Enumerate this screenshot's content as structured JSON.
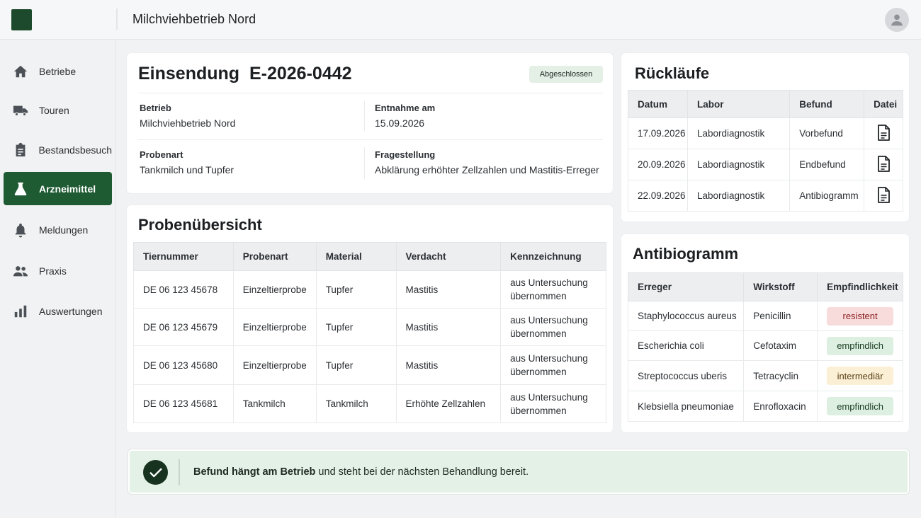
{
  "topbar": {
    "title": "Milchviehbetrieb Nord",
    "logo_icon": "app-logo",
    "avatar_icon": "user-avatar-icon"
  },
  "sidebar": {
    "items": [
      {
        "label": "Betriebe",
        "icon": "home-icon",
        "active": false
      },
      {
        "label": "Touren",
        "icon": "truck-icon",
        "active": false
      },
      {
        "label": "Bestandsbesuch",
        "icon": "clipboard-icon",
        "active": false
      },
      {
        "label": "Arzneimittel",
        "icon": "flask-icon",
        "active": true
      },
      {
        "label": "Meldungen",
        "icon": "bell-icon",
        "active": false
      },
      {
        "label": "Praxis",
        "icon": "people-icon",
        "active": false
      },
      {
        "label": "Auswertungen",
        "icon": "bar-chart-icon",
        "active": false
      }
    ],
    "active_color": "#1e5a32"
  },
  "submission": {
    "title": "Einsendung",
    "id": "E-2026-0442",
    "status": "Abgeschlossen",
    "fields": {
      "betrieb_label": "Betrieb",
      "betrieb_value": "Milchviehbetrieb Nord",
      "entnahme_label": "Entnahme am",
      "entnahme_value": "15.09.2026",
      "probenart_label": "Probenart",
      "probenart_value": "Tankmilch und Tupfer",
      "fragestellung_label": "Fragestellung",
      "fragestellung_value": "Abklärung erhöhter Zellzahlen und Mastitis-Erreger"
    }
  },
  "samples": {
    "title": "Probenübersicht",
    "columns": [
      "Tiernummer",
      "Probenart",
      "Material",
      "Verdacht",
      "Kennzeichnung"
    ],
    "rows": [
      [
        "DE 06 123 45678",
        "Einzeltierprobe",
        "Tupfer",
        "Mastitis",
        "aus Untersuchung übernommen"
      ],
      [
        "DE 06 123 45679",
        "Einzeltierprobe",
        "Tupfer",
        "Mastitis",
        "aus Untersuchung übernommen"
      ],
      [
        "DE 06 123 45680",
        "Einzeltierprobe",
        "Tupfer",
        "Mastitis",
        "aus Untersuchung übernommen"
      ],
      [
        "DE 06 123 45681",
        "Tankmilch",
        "Tankmilch",
        "Erhöhte Zellzahlen",
        "aus Untersuchung übernommen"
      ]
    ]
  },
  "returns": {
    "title": "Rückläufe",
    "columns": [
      "Datum",
      "Labor",
      "Befund",
      "Datei"
    ],
    "rows": [
      {
        "datum": "17.09.2026",
        "labor": "Labordiagnostik",
        "befund": "Vorbefund",
        "file_icon": "document-icon"
      },
      {
        "datum": "20.09.2026",
        "labor": "Labordiagnostik",
        "befund": "Endbefund",
        "file_icon": "document-icon"
      },
      {
        "datum": "22.09.2026",
        "labor": "Labordiagnostik",
        "befund": "Antibiogramm",
        "file_icon": "document-icon"
      }
    ]
  },
  "antibiogram": {
    "title": "Antibiogramm",
    "columns": [
      "Erreger",
      "Wirkstoff",
      "Empfindlichkeit"
    ],
    "rows": [
      {
        "erreger": "Staphylococcus aureus",
        "wirkstoff": "Penicillin",
        "result": "resistent",
        "color": "#f8dcdc"
      },
      {
        "erreger": "Escherichia coli",
        "wirkstoff": "Cefotaxim",
        "result": "empfindlich",
        "color": "#dcefe0"
      },
      {
        "erreger": "Streptococcus uberis",
        "wirkstoff": "Tetracyclin",
        "result": "intermediär",
        "color": "#fbefd6"
      },
      {
        "erreger": "Klebsiella pneumoniae",
        "wirkstoff": "Enrofloxacin",
        "result": "empfindlich",
        "color": "#dcefe0"
      }
    ]
  },
  "banner": {
    "bold": "Befund hängt am Betrieb",
    "rest": " und steht bei der nächsten Behandlung bereit.",
    "icon": "check-icon"
  }
}
